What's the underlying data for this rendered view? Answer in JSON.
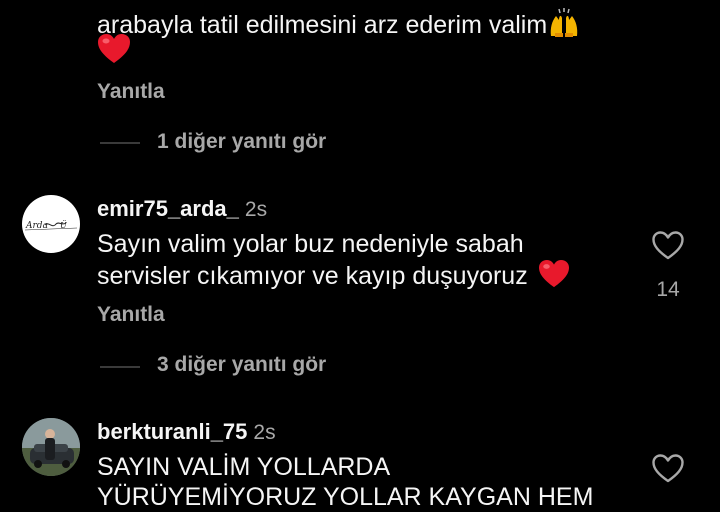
{
  "comment1": {
    "text_line": "arabayla tatil edilmesini arz ederim valim",
    "reply_label": "Yanıtla",
    "more_replies": "1 diğer yanıtı gör"
  },
  "comment2": {
    "username": "emir75_arda_",
    "time": "2s",
    "text_line1": "Sayın valim yolar buz nedeniyle sabah",
    "text_line2": "servisler  cıkamıyor ve kayıp duşuyoruz",
    "likes": "14",
    "reply_label": "Yanıtla",
    "more_replies": "3 diğer yanıtı gör"
  },
  "comment3": {
    "username": "berkturanli_75",
    "time": "2s",
    "text_line1": "SAYIN VALİM YOLLARDA",
    "text_line2": "YÜRÜYEMİYORUZ YOLLAR KAYGAN HEM"
  },
  "icons": {
    "heart_outline": "heart-outline-icon",
    "red_heart": "red-heart-emoji",
    "raised_hands": "raising-hands-emoji"
  },
  "colors": {
    "background": "#000000",
    "text": "#f5f5f5",
    "secondary": "#a8a8a8",
    "heart_red": "#e8192c"
  }
}
